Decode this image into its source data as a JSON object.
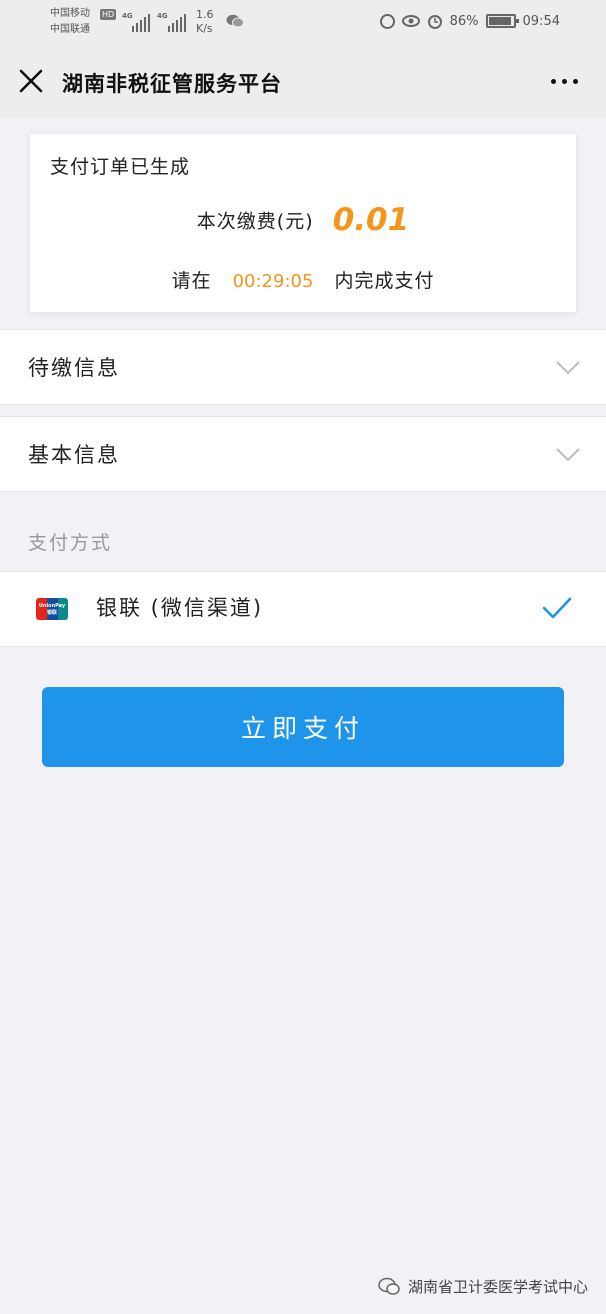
{
  "status_bar": {
    "carrier_1": "中国移动",
    "carrier_2": "中国联通",
    "hd_badge": "HD",
    "network_1": "4G",
    "network_2": "4G",
    "speed_value": "1.6",
    "speed_unit": "K/s",
    "battery": "86%",
    "time": "09:54"
  },
  "title_bar": {
    "title": "湖南非税征管服务平台",
    "close_icon": "close-icon",
    "more_icon": "more-dots-icon"
  },
  "order": {
    "status": "支付订单已生成",
    "fee_label": "本次缴费(元)",
    "fee_amount": "0.01",
    "timer_prefix": "请在",
    "timer": "00:29:05",
    "timer_suffix": "内完成支付"
  },
  "sections": [
    {
      "label": "待缴信息",
      "icon": "chevron-down-icon"
    },
    {
      "label": "基本信息",
      "icon": "chevron-down-icon"
    }
  ],
  "payment": {
    "title": "支付方式",
    "method": {
      "logo_text": "UnionPay 银联",
      "label": "银联 (微信渠道)",
      "selected": true
    },
    "button": "立即支付"
  },
  "watermark": "湖南省卫计委医学考试中心",
  "colors": {
    "accent_blue": "#1e95ea",
    "amount_orange": "#f2961c",
    "background": "#f1f1f6"
  }
}
